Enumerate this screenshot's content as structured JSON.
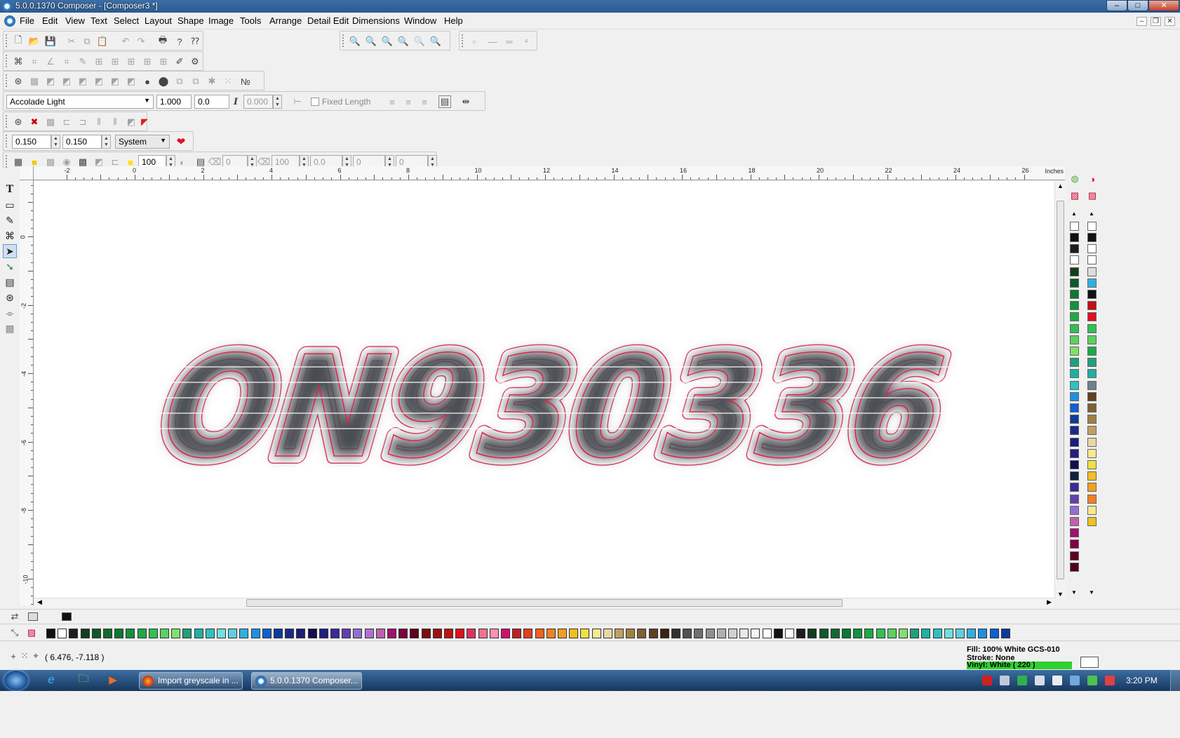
{
  "window": {
    "title": "5.0.0.1370 Composer - [Composer3 *]",
    "minimize": "–",
    "maximize": "□",
    "close": "✕"
  },
  "menu": {
    "items": [
      "File",
      "Edit",
      "View",
      "Text",
      "Select",
      "Layout",
      "Shape",
      "Image",
      "Tools",
      "Arrange",
      "Detail Edit",
      "Dimensions",
      "Window",
      "Help"
    ]
  },
  "text_toolbar": {
    "font": "Accolade Light",
    "size": "1.000",
    "spacing": "0.0",
    "italic_glyph": "I",
    "slant": "0.000",
    "fixed_length_label": "Fixed Length"
  },
  "outline_toolbar": {
    "width_a": "0.150",
    "width_b": "0.150",
    "units": "System"
  },
  "fill_toolbar": {
    "opacity": "100",
    "v1": "0",
    "v2": "100",
    "v3": "0.0",
    "v4": "0",
    "v5": "0"
  },
  "ruler": {
    "units": "Inches",
    "h_labels": [
      "-2",
      "0",
      "2",
      "4",
      "6",
      "8",
      "10",
      "12",
      "14",
      "16",
      "18",
      "20",
      "22",
      "24",
      "26"
    ],
    "v_labels": [
      "0",
      "-2",
      "-4",
      "-6",
      "-8",
      "-10"
    ]
  },
  "canvas": {
    "artwork_text": "ON930336",
    "fill_color": "#4a4e52",
    "outline_color": "#e0234a"
  },
  "status": {
    "coords": "( 6.476, -7.118 )",
    "fill": "Fill: 100% White GCS-010",
    "stroke": "Stroke: None",
    "vinyl": "Vinyl: White ( 220 )"
  },
  "taskbar": {
    "items": [
      "Import greyscale in ...",
      "5.0.0.1370 Composer..."
    ],
    "clock": "3:20 PM"
  },
  "icons": {
    "new": "new-file-icon",
    "open": "open-folder-icon",
    "save": "save-icon",
    "cut": "cut-icon",
    "copy": "copy-icon",
    "paste": "paste-icon",
    "undo": "undo-icon",
    "redo": "redo-icon",
    "print": "print-icon",
    "help": "help-icon",
    "context_help": "context-help-icon",
    "zoom_in": "zoom-in-icon",
    "zoom_all": "zoom-all-icon",
    "zoom_out": "zoom-out-icon",
    "zoom_prev": "zoom-previous-icon",
    "zoom_sel": "zoom-selection-icon",
    "zoom_fit": "zoom-fit-icon"
  },
  "colors": {
    "titlebar": "#2b5a91",
    "taskbar": "#1d3f6b",
    "accent": "#e0234a"
  },
  "palette_colors": [
    "#111",
    "#fff",
    "#1d1d1d",
    "#123e1e",
    "#0c5a2a",
    "#126b2e",
    "#0a7a33",
    "#15913c",
    "#1eaa45",
    "#30c050",
    "#5cd060",
    "#80e070",
    "#1fa07a",
    "#1fb0a0",
    "#30c0c0",
    "#6fe0e0",
    "#5fcfe0",
    "#30b0e0",
    "#1e90e0",
    "#1060d0",
    "#0e3a9e",
    "#1a2a8a",
    "#1c1c7a",
    "#101050",
    "#202080",
    "#3a2a9a",
    "#6040b0",
    "#9070d0",
    "#b070d0",
    "#c060b0",
    "#a01070",
    "#800040",
    "#600020",
    "#7a1010",
    "#a01010",
    "#c01010",
    "#e01020",
    "#e03060",
    "#f07090",
    "#ff90b0",
    "#d01070",
    "#c02020",
    "#e04020",
    "#f06020",
    "#f08020",
    "#f0a020",
    "#f0c020",
    "#f0e040",
    "#f8e890",
    "#e8d8a0",
    "#c0a060",
    "#a08040",
    "#806030",
    "#604020",
    "#402010",
    "#303030",
    "#505050",
    "#707070",
    "#909090",
    "#b0b0b0",
    "#d0d0d0",
    "#e8e8e8",
    "#f4f4f4",
    "#fff"
  ]
}
